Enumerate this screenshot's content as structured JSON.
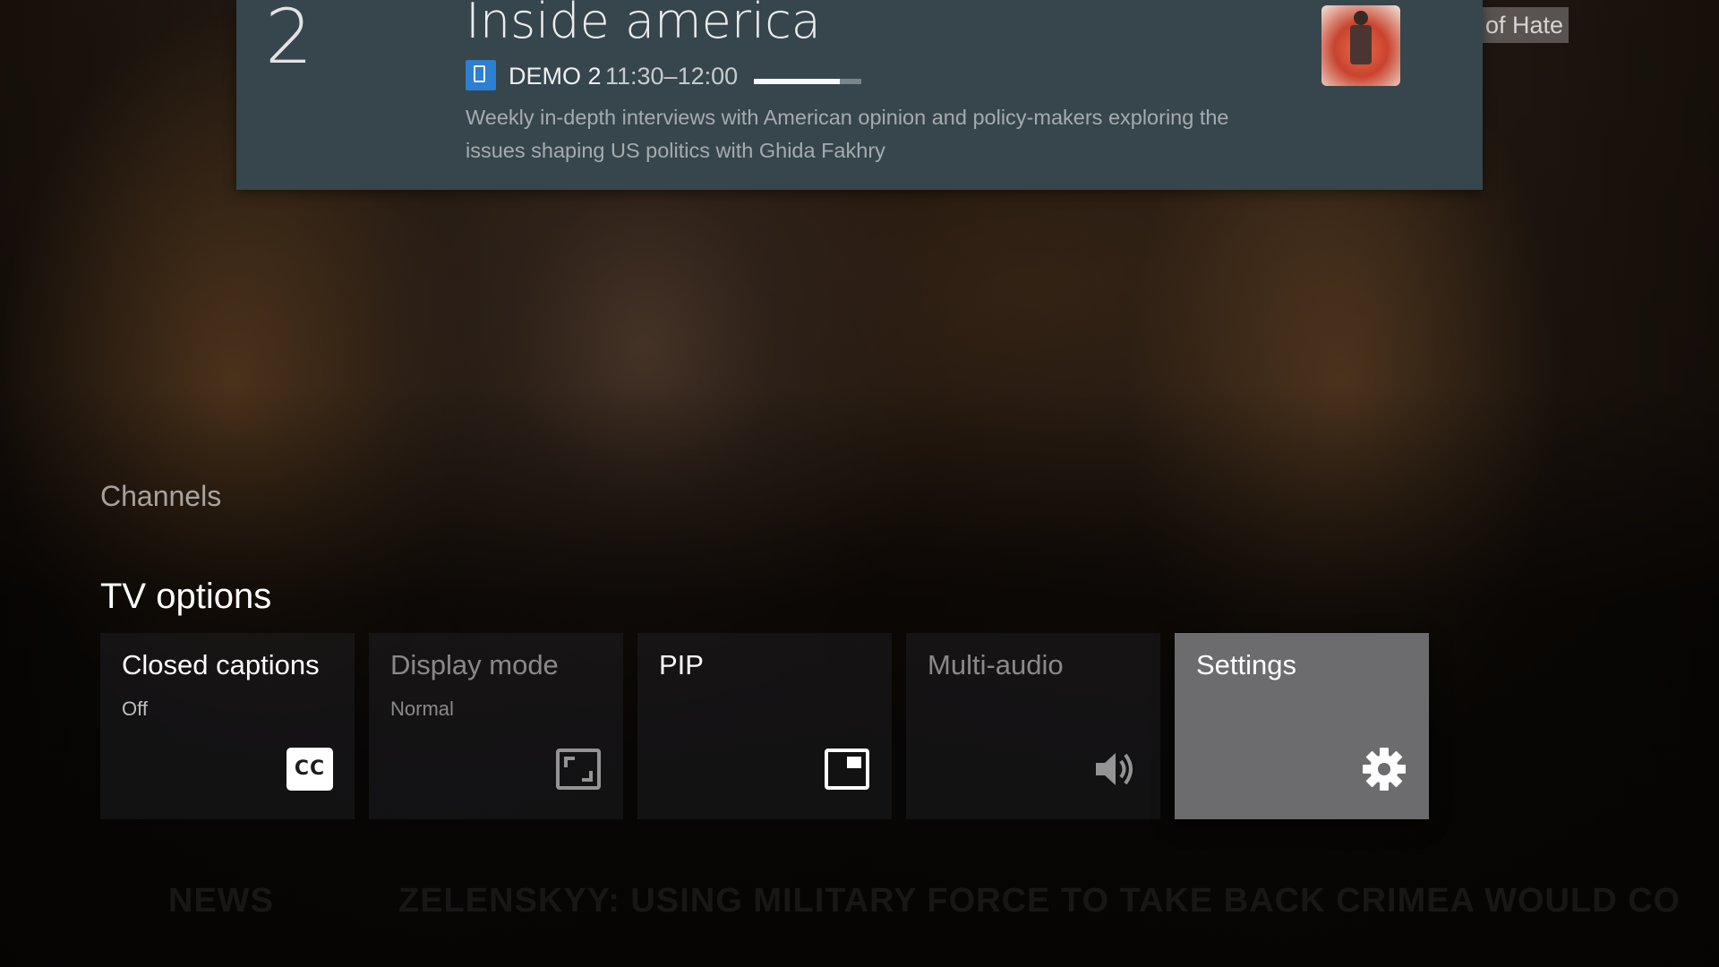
{
  "background": {
    "caption_fragment": "of Hate",
    "ticker_label": "NEWS",
    "ticker_text": "ZELENSKYY: USING MILITARY FORCE TO TAKE BACK CRIMEA WOULD CO"
  },
  "program_banner": {
    "channel_number": "2",
    "title": "Inside america",
    "channel_logo_icon": "channel-logo-icon",
    "channel_name": "DEMO 2",
    "time": "11:30–12:00",
    "progress_fraction": 0.8,
    "description": "Weekly in-depth interviews with American opinion and policy-makers exploring the issues shaping US politics with Ghida Fakhry"
  },
  "panel": {
    "channels_label": "Channels",
    "tv_options_label": "TV options",
    "options": [
      {
        "title": "Closed captions",
        "subtitle": "Off",
        "icon": "closed-captions-icon",
        "icon_text": "CC",
        "state": "normal"
      },
      {
        "title": "Display mode",
        "subtitle": "Normal",
        "icon": "display-mode-icon",
        "state": "disabled"
      },
      {
        "title": "PIP",
        "subtitle": "",
        "icon": "picture-in-picture-icon",
        "state": "normal"
      },
      {
        "title": "Multi-audio",
        "subtitle": "",
        "icon": "speaker-icon",
        "state": "disabled"
      },
      {
        "title": "Settings",
        "subtitle": "",
        "icon": "gear-icon",
        "state": "focused"
      }
    ]
  },
  "colors": {
    "banner_background": "#37454c",
    "focused_card": "#6c6c6e",
    "channel_logo": "#2d7fd1"
  }
}
